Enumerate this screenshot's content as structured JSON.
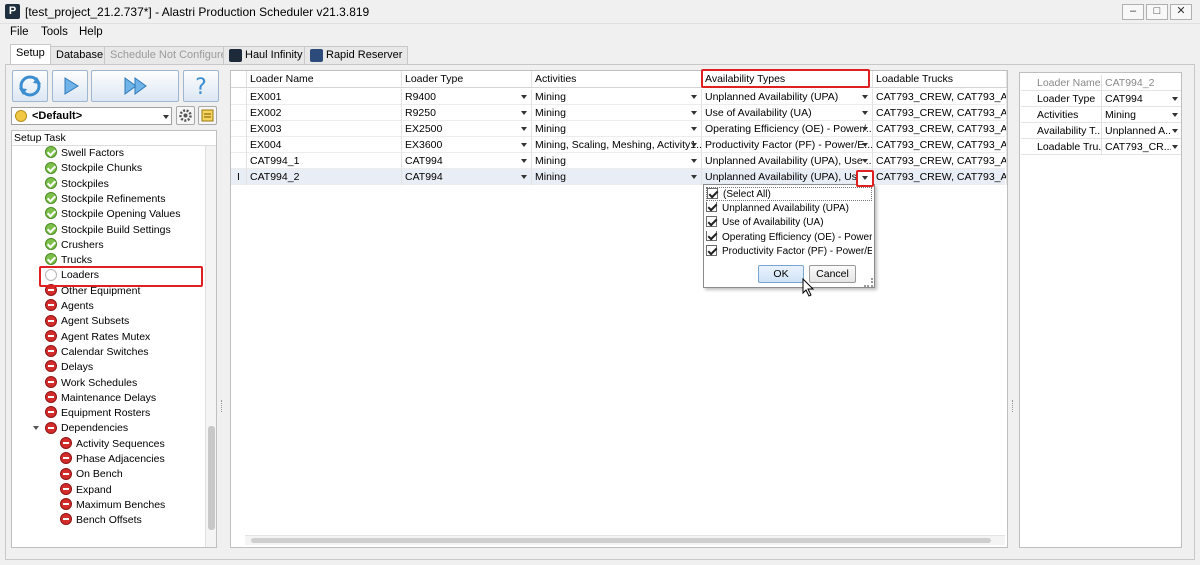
{
  "window": {
    "title": "[test_project_21.2.737*] - Alastri Production Scheduler v21.3.819",
    "app_letter": "P"
  },
  "menu": [
    "File",
    "Tools",
    "Help"
  ],
  "tabs": [
    {
      "label": "Setup"
    },
    {
      "label": "Database"
    },
    {
      "label": "Schedule Not Configured"
    },
    {
      "label": "Haul Infinity"
    },
    {
      "label": "Rapid Reserver"
    }
  ],
  "left": {
    "scenario": "<Default>",
    "tree_header": "Setup Task",
    "items": [
      {
        "label": "Swell Factors",
        "status": "ok"
      },
      {
        "label": "Stockpile Chunks",
        "status": "ok"
      },
      {
        "label": "Stockpiles",
        "status": "ok"
      },
      {
        "label": "Stockpile Refinements",
        "status": "ok"
      },
      {
        "label": "Stockpile Opening Values",
        "status": "ok"
      },
      {
        "label": "Stockpile Build Settings",
        "status": "ok"
      },
      {
        "label": "Crushers",
        "status": "ok"
      },
      {
        "label": "Trucks",
        "status": "ok"
      },
      {
        "label": "Loaders",
        "status": "empty"
      },
      {
        "label": "Other Equipment",
        "status": "no"
      },
      {
        "label": "Agents",
        "status": "no"
      },
      {
        "label": "Agent Subsets",
        "status": "no"
      },
      {
        "label": "Agent Rates Mutex",
        "status": "no"
      },
      {
        "label": "Calendar Switches",
        "status": "no"
      },
      {
        "label": "Delays",
        "status": "no"
      },
      {
        "label": "Work Schedules",
        "status": "no"
      },
      {
        "label": "Maintenance Delays",
        "status": "no"
      },
      {
        "label": "Equipment Rosters",
        "status": "no"
      },
      {
        "label": "Dependencies",
        "status": "no"
      },
      {
        "label": "Activity Sequences",
        "status": "no"
      },
      {
        "label": "Phase Adjacencies",
        "status": "no"
      },
      {
        "label": "On Bench",
        "status": "no"
      },
      {
        "label": "Expand",
        "status": "no"
      },
      {
        "label": "Maximum Benches",
        "status": "no"
      },
      {
        "label": "Bench Offsets",
        "status": "no"
      }
    ]
  },
  "grid": {
    "columns": [
      "Loader Name",
      "Loader Type",
      "Activities",
      "Availability Types",
      "Loadable Trucks"
    ],
    "rows": [
      [
        "EX001",
        "R9400",
        "Mining",
        "Unplanned Availability (UPA)",
        "CAT793_CREW, CAT793_A..."
      ],
      [
        "EX002",
        "R9250",
        "Mining",
        "Use of Availability (UA)",
        "CAT793_CREW, CAT793_A..."
      ],
      [
        "EX003",
        "EX2500",
        "Mining",
        "Operating Efficiency (OE) - Power/...",
        "CAT793_CREW, CAT793_A..."
      ],
      [
        "EX004",
        "EX3600",
        "Mining, Scaling, Meshing, Activity1...",
        "Productivity Factor (PF) - Power/E...",
        "CAT793_CREW, CAT793_A..."
      ],
      [
        "CAT994_1",
        "CAT994",
        "Mining",
        "Unplanned Availability (UPA), Use ...",
        "CAT793_CREW, CAT793_A..."
      ],
      [
        "CAT994_2",
        "CAT994",
        "Mining",
        "Unplanned Availability (UPA), Use ...",
        "CAT793_CREW, CAT793_A..."
      ]
    ],
    "row_marker": "I"
  },
  "popup": {
    "options": [
      "(Select All)",
      "Unplanned Availability (UPA)",
      "Use of Availability (UA)",
      "Operating Efficiency (OE) - Power/E",
      "Productivity Factor (PF) - Power/En"
    ],
    "ok": "OK",
    "cancel": "Cancel"
  },
  "props": {
    "rows": [
      {
        "label": "Loader Name",
        "value": "CAT994_2"
      },
      {
        "label": "Loader Type",
        "value": "CAT994"
      },
      {
        "label": "Activities",
        "value": "Mining"
      },
      {
        "label": "Availability T...",
        "value": "Unplanned A..."
      },
      {
        "label": "Loadable Tru...",
        "value": "CAT793_CR..."
      }
    ]
  },
  "window_buttons": {
    "minimize": "–",
    "maximize": "□",
    "close": "✕"
  }
}
